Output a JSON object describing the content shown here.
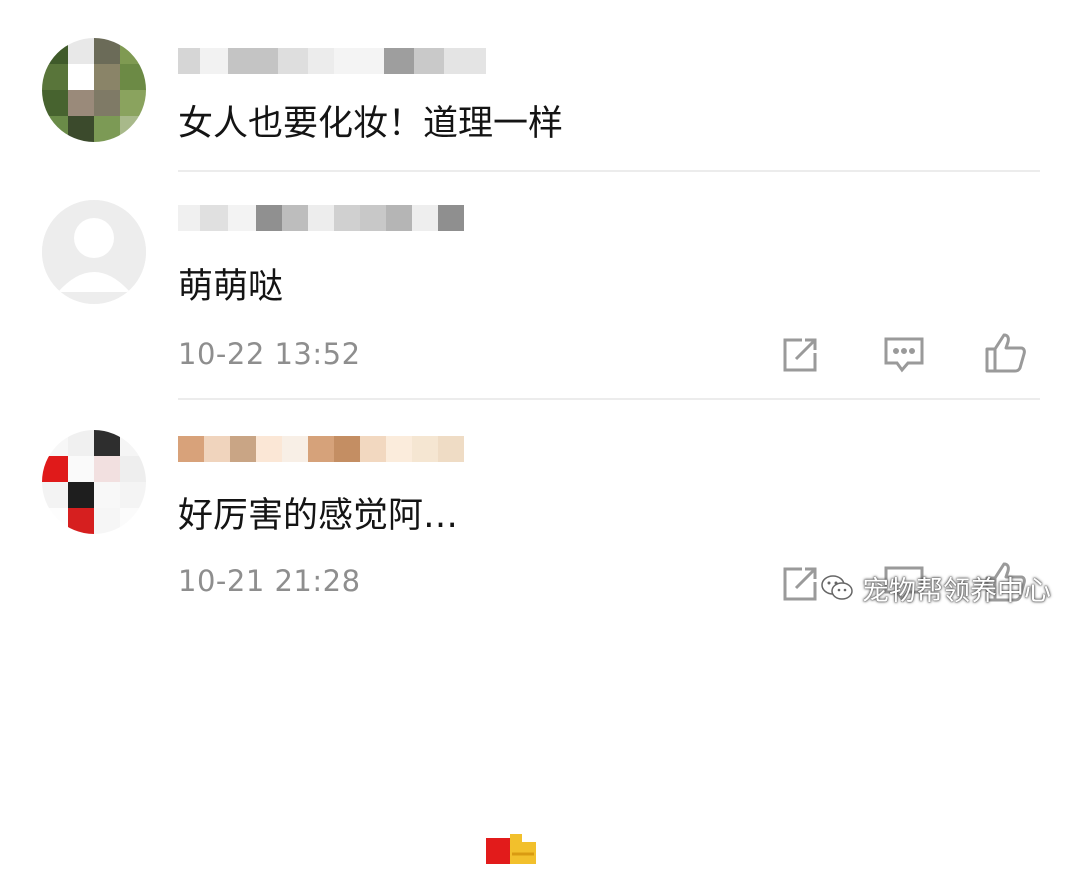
{
  "comments": [
    {
      "text": "女人也要化妆！道理一样",
      "avatar_icon": "mosaic-avatar-icon"
    },
    {
      "text": "萌萌哒",
      "timestamp": "10-22 13:52",
      "avatar_icon": "default-user-avatar-icon"
    },
    {
      "text": "好厉害的感觉阿…",
      "timestamp": "10-21 21:28",
      "avatar_icon": "mosaic-avatar-icon"
    }
  ],
  "actions": {
    "share_icon": "share-icon",
    "reply_icon": "comment-icon",
    "like_icon": "thumbs-up-icon"
  },
  "watermark": {
    "text": "宠物帮领养中心",
    "icon": "wechat-icon"
  },
  "colors": {
    "text": "#141414",
    "timestamp": "#8e8e8e",
    "icon": "#9a9a9a",
    "divider": "#ececec"
  }
}
